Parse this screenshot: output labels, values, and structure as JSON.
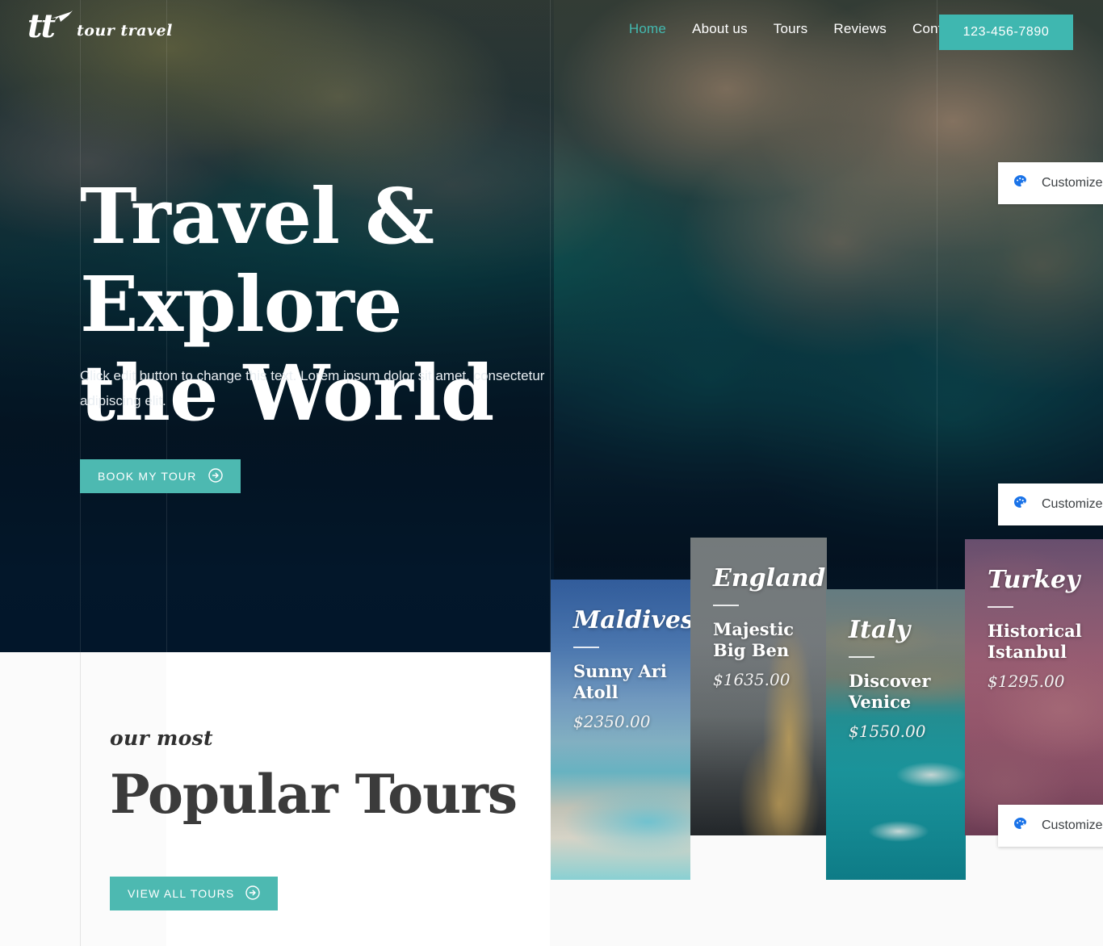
{
  "site": {
    "logo_mark": "tt",
    "logo_word": "tour travel",
    "logo_icon": "airplane-icon",
    "accent_color": "#4db9b1",
    "phone_button_color": "#3fb7b0",
    "nav_active_color": "#43b9b0"
  },
  "nav": {
    "items": [
      {
        "label": "Home",
        "active": true
      },
      {
        "label": "About us",
        "active": false
      },
      {
        "label": "Tours",
        "active": false
      },
      {
        "label": "Reviews",
        "active": false
      },
      {
        "label": "Contact",
        "active": false
      }
    ],
    "phone": "123-456-7890"
  },
  "hero": {
    "title_line1": "Travel & Explore",
    "title_line2": "the World",
    "subtitle": "Click edit button to change this text. Lorem ipsum dolor sit amet, consectetur adipiscing elit.",
    "cta_label": "BOOK MY TOUR",
    "cta_icon": "arrow-circle-right-icon"
  },
  "tours_section": {
    "eyebrow": "our most",
    "title": "Popular Tours",
    "cta_label": "VIEW ALL TOURS",
    "cta_icon": "arrow-circle-right-icon"
  },
  "tours": [
    {
      "country": "Maldives",
      "name": "Sunny Ari Atoll",
      "price": "$2350.00"
    },
    {
      "country": "England",
      "name": "Majestic Big Ben",
      "price": "$1635.00"
    },
    {
      "country": "Italy",
      "name": "Discover Venice",
      "price": "$1550.00"
    },
    {
      "country": "Turkey",
      "name": "Historical Istanbul",
      "price": "$1295.00"
    }
  ],
  "customize_buttons": [
    {
      "label": "Customize",
      "icon": "palette-icon"
    },
    {
      "label": "Customize",
      "icon": "palette-icon"
    },
    {
      "label": "Customize",
      "icon": "palette-icon"
    }
  ]
}
